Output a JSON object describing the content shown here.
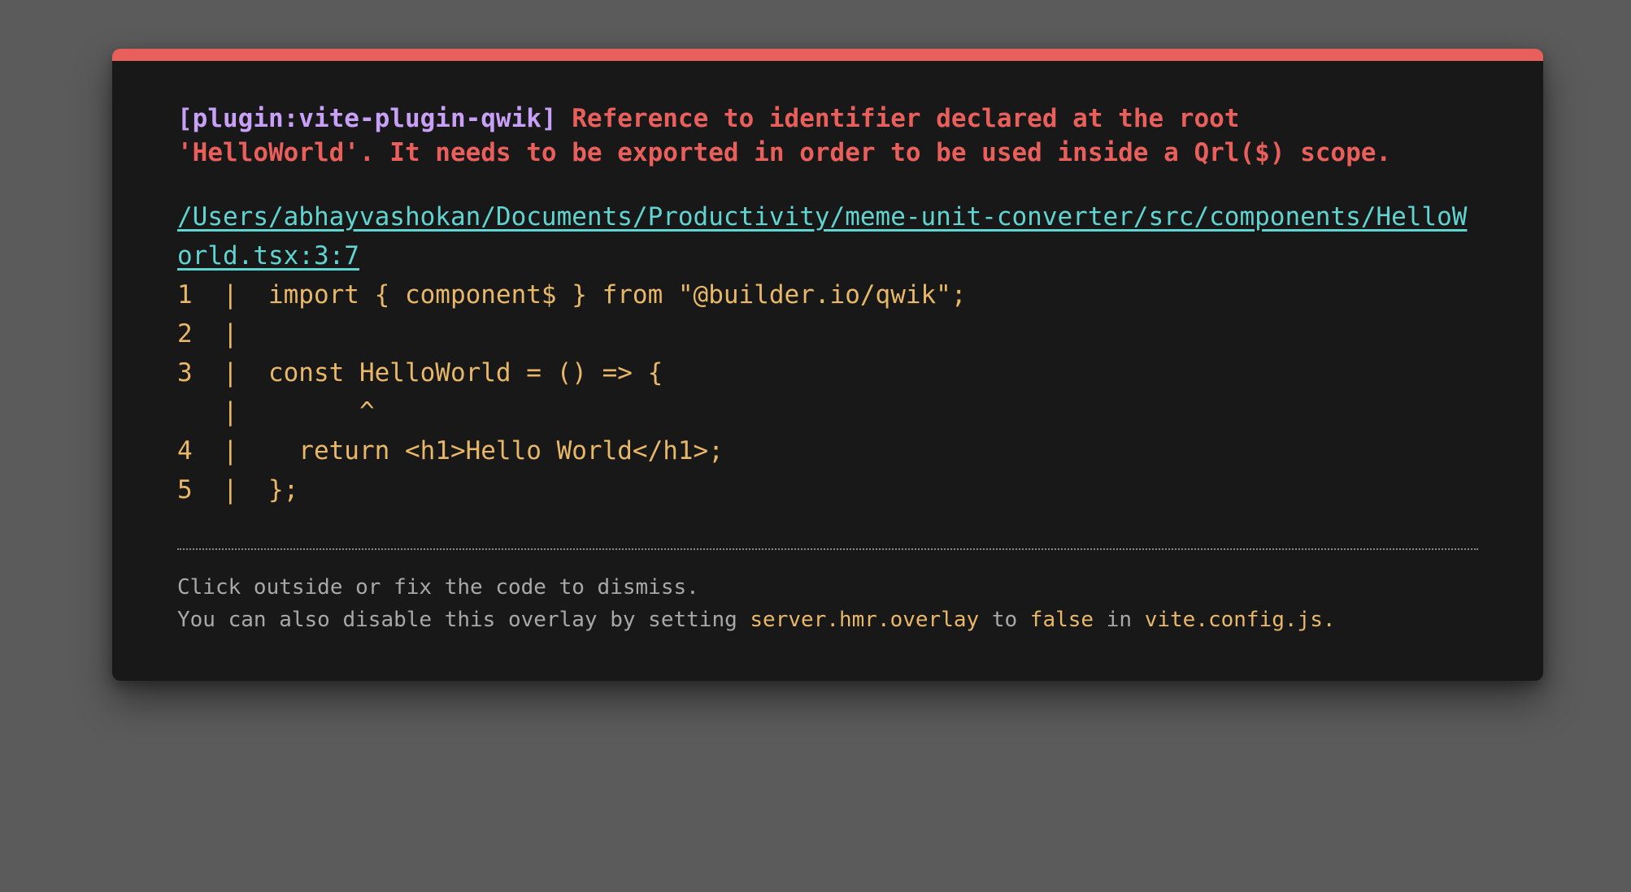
{
  "error": {
    "plugin": "[plugin:vite-plugin-qwik]",
    "message_line1": "Reference to identifier declared at the root",
    "message_line2": "'HelloWorld'. It needs to be exported in order to be used inside a Qrl($) scope.",
    "file": "/Users/abhayvashokan/Documents/Productivity/meme-unit-converter/src/components/HelloWorld.tsx:3:7"
  },
  "frame": [
    "1  |  import { component$ } from \"@builder.io/qwik\";",
    "2  |",
    "3  |  const HelloWorld = () => {",
    "   |        ^",
    "4  |    return <h1>Hello World</h1>;",
    "5  |  };"
  ],
  "tip": {
    "line1": "Click outside or fix the code to dismiss.",
    "line2_prefix": "You can also disable this overlay by setting ",
    "setting": "server.hmr.overlay",
    "word_to": " to ",
    "value": "false",
    "word_in": " in ",
    "config_file": "vite.config.js",
    "period": "."
  },
  "colors": {
    "accent_red": "#e85f5b",
    "plugin_purple": "#c9a0f8",
    "link_cyan": "#5fd4d0",
    "code_yellow": "#e8b868",
    "backdrop": "#5b5b5b",
    "window": "#181818"
  }
}
